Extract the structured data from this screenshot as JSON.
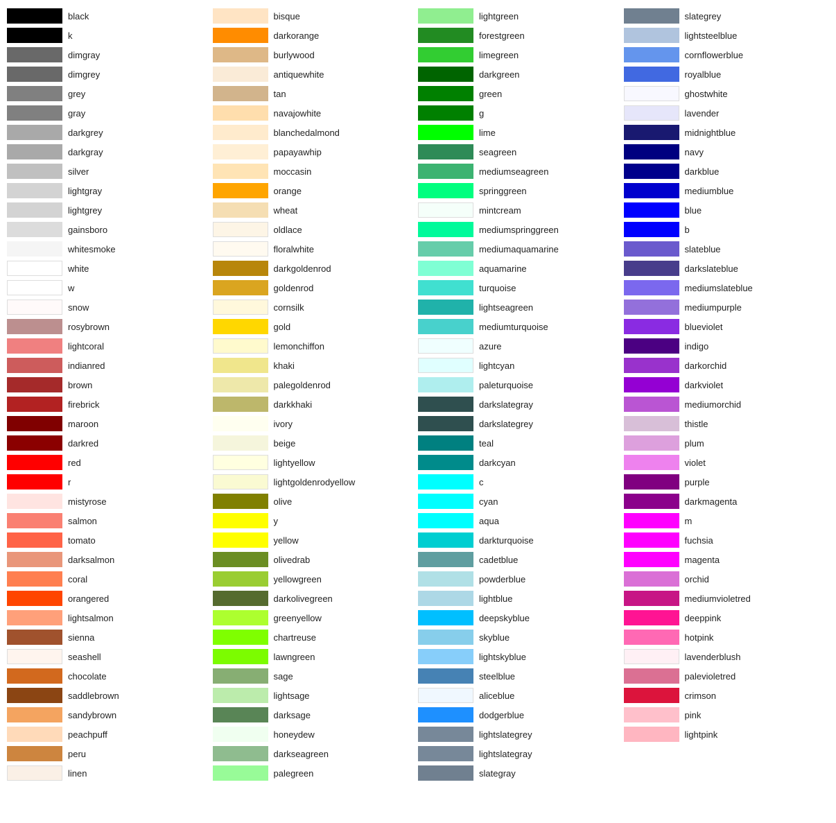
{
  "columns": [
    {
      "id": "col1",
      "items": [
        {
          "name": "black",
          "color": "#000000"
        },
        {
          "name": "k",
          "color": "#000000"
        },
        {
          "name": "dimgray",
          "color": "#696969"
        },
        {
          "name": "dimgrey",
          "color": "#696969"
        },
        {
          "name": "grey",
          "color": "#808080"
        },
        {
          "name": "gray",
          "color": "#808080"
        },
        {
          "name": "darkgrey",
          "color": "#a9a9a9"
        },
        {
          "name": "darkgray",
          "color": "#a9a9a9"
        },
        {
          "name": "silver",
          "color": "#c0c0c0"
        },
        {
          "name": "lightgray",
          "color": "#d3d3d3"
        },
        {
          "name": "lightgrey",
          "color": "#d3d3d3"
        },
        {
          "name": "gainsboro",
          "color": "#dcdcdc"
        },
        {
          "name": "whitesmoke",
          "color": "#f5f5f5"
        },
        {
          "name": "white",
          "color": "#ffffff"
        },
        {
          "name": "w",
          "color": "#ffffff"
        },
        {
          "name": "snow",
          "color": "#fffafa"
        },
        {
          "name": "rosybrown",
          "color": "#bc8f8f"
        },
        {
          "name": "lightcoral",
          "color": "#f08080"
        },
        {
          "name": "indianred",
          "color": "#cd5c5c"
        },
        {
          "name": "brown",
          "color": "#a52a2a"
        },
        {
          "name": "firebrick",
          "color": "#b22222"
        },
        {
          "name": "maroon",
          "color": "#800000"
        },
        {
          "name": "darkred",
          "color": "#8b0000"
        },
        {
          "name": "red",
          "color": "#ff0000"
        },
        {
          "name": "r",
          "color": "#ff0000"
        },
        {
          "name": "mistyrose",
          "color": "#ffe4e1"
        },
        {
          "name": "salmon",
          "color": "#fa8072"
        },
        {
          "name": "tomato",
          "color": "#ff6347"
        },
        {
          "name": "darksalmon",
          "color": "#e9967a"
        },
        {
          "name": "coral",
          "color": "#ff7f50"
        },
        {
          "name": "orangered",
          "color": "#ff4500"
        },
        {
          "name": "lightsalmon",
          "color": "#ffa07a"
        },
        {
          "name": "sienna",
          "color": "#a0522d"
        },
        {
          "name": "seashell",
          "color": "#fff5ee"
        },
        {
          "name": "chocolate",
          "color": "#d2691e"
        },
        {
          "name": "saddlebrown",
          "color": "#8b4513"
        },
        {
          "name": "sandybrown",
          "color": "#f4a460"
        },
        {
          "name": "peachpuff",
          "color": "#ffdab9"
        },
        {
          "name": "peru",
          "color": "#cd853f"
        },
        {
          "name": "linen",
          "color": "#faf0e6"
        }
      ]
    },
    {
      "id": "col2",
      "items": [
        {
          "name": "bisque",
          "color": "#ffe4c4"
        },
        {
          "name": "darkorange",
          "color": "#ff8c00"
        },
        {
          "name": "burlywood",
          "color": "#deb887"
        },
        {
          "name": "antiquewhite",
          "color": "#faebd7"
        },
        {
          "name": "tan",
          "color": "#d2b48c"
        },
        {
          "name": "navajowhite",
          "color": "#ffdead"
        },
        {
          "name": "blanchedalmond",
          "color": "#ffebcd"
        },
        {
          "name": "papayawhip",
          "color": "#ffefd5"
        },
        {
          "name": "moccasin",
          "color": "#ffe4b5"
        },
        {
          "name": "orange",
          "color": "#ffa500"
        },
        {
          "name": "wheat",
          "color": "#f5deb3"
        },
        {
          "name": "oldlace",
          "color": "#fdf5e6"
        },
        {
          "name": "floralwhite",
          "color": "#fffaf0"
        },
        {
          "name": "darkgoldenrod",
          "color": "#b8860b"
        },
        {
          "name": "goldenrod",
          "color": "#daa520"
        },
        {
          "name": "cornsilk",
          "color": "#fff8dc"
        },
        {
          "name": "gold",
          "color": "#ffd700"
        },
        {
          "name": "lemonchiffon",
          "color": "#fffacd"
        },
        {
          "name": "khaki",
          "color": "#f0e68c"
        },
        {
          "name": "palegoldenrod",
          "color": "#eee8aa"
        },
        {
          "name": "darkkhaki",
          "color": "#bdb76b"
        },
        {
          "name": "ivory",
          "color": "#fffff0"
        },
        {
          "name": "beige",
          "color": "#f5f5dc"
        },
        {
          "name": "lightyellow",
          "color": "#ffffe0"
        },
        {
          "name": "lightgoldenrodyellow",
          "color": "#fafad2"
        },
        {
          "name": "olive",
          "color": "#808000"
        },
        {
          "name": "y",
          "color": "#ffff00"
        },
        {
          "name": "yellow",
          "color": "#ffff00"
        },
        {
          "name": "olivedrab",
          "color": "#6b8e23"
        },
        {
          "name": "yellowgreen",
          "color": "#9acd32"
        },
        {
          "name": "darkolivegreen",
          "color": "#556b2f"
        },
        {
          "name": "greenyellow",
          "color": "#adff2f"
        },
        {
          "name": "chartreuse",
          "color": "#7fff00"
        },
        {
          "name": "lawngreen",
          "color": "#7cfc00"
        },
        {
          "name": "sage",
          "color": "#87ae73"
        },
        {
          "name": "lightsage",
          "color": "#bcecac"
        },
        {
          "name": "darksage",
          "color": "#598556"
        },
        {
          "name": "honeydew",
          "color": "#f0fff0"
        },
        {
          "name": "darkseagreen",
          "color": "#8fbc8f"
        },
        {
          "name": "palegreen",
          "color": "#98fb98"
        }
      ]
    },
    {
      "id": "col3",
      "items": [
        {
          "name": "lightgreen",
          "color": "#90ee90"
        },
        {
          "name": "forestgreen",
          "color": "#228b22"
        },
        {
          "name": "limegreen",
          "color": "#32cd32"
        },
        {
          "name": "darkgreen",
          "color": "#006400"
        },
        {
          "name": "green",
          "color": "#008000"
        },
        {
          "name": "g",
          "color": "#008000"
        },
        {
          "name": "lime",
          "color": "#00ff00"
        },
        {
          "name": "seagreen",
          "color": "#2e8b57"
        },
        {
          "name": "mediumseagreen",
          "color": "#3cb371"
        },
        {
          "name": "springgreen",
          "color": "#00ff7f"
        },
        {
          "name": "mintcream",
          "color": "#f5fffa"
        },
        {
          "name": "mediumspringgreen",
          "color": "#00fa9a"
        },
        {
          "name": "mediumaquamarine",
          "color": "#66cdaa"
        },
        {
          "name": "aquamarine",
          "color": "#7fffd4"
        },
        {
          "name": "turquoise",
          "color": "#40e0d0"
        },
        {
          "name": "lightseagreen",
          "color": "#20b2aa"
        },
        {
          "name": "mediumturquoise",
          "color": "#48d1cc"
        },
        {
          "name": "azure",
          "color": "#f0ffff"
        },
        {
          "name": "lightcyan",
          "color": "#e0ffff"
        },
        {
          "name": "paleturquoise",
          "color": "#afeeee"
        },
        {
          "name": "darkslategray",
          "color": "#2f4f4f"
        },
        {
          "name": "darkslategrey",
          "color": "#2f4f4f"
        },
        {
          "name": "teal",
          "color": "#008080"
        },
        {
          "name": "darkcyan",
          "color": "#008b8b"
        },
        {
          "name": "c",
          "color": "#00ffff"
        },
        {
          "name": "cyan",
          "color": "#00ffff"
        },
        {
          "name": "aqua",
          "color": "#00ffff"
        },
        {
          "name": "darkturquoise",
          "color": "#00ced1"
        },
        {
          "name": "cadetblue",
          "color": "#5f9ea0"
        },
        {
          "name": "powderblue",
          "color": "#b0e0e6"
        },
        {
          "name": "lightblue",
          "color": "#add8e6"
        },
        {
          "name": "deepskyblue",
          "color": "#00bfff"
        },
        {
          "name": "skyblue",
          "color": "#87ceeb"
        },
        {
          "name": "lightskyblue",
          "color": "#87cefa"
        },
        {
          "name": "steelblue",
          "color": "#4682b4"
        },
        {
          "name": "aliceblue",
          "color": "#f0f8ff"
        },
        {
          "name": "dodgerblue",
          "color": "#1e90ff"
        },
        {
          "name": "lightslategrey",
          "color": "#778899"
        },
        {
          "name": "lightslategray",
          "color": "#778899"
        },
        {
          "name": "slategray",
          "color": "#708090"
        }
      ]
    },
    {
      "id": "col4",
      "items": [
        {
          "name": "slategrey",
          "color": "#708090"
        },
        {
          "name": "lightsteelblue",
          "color": "#b0c4de"
        },
        {
          "name": "cornflowerblue",
          "color": "#6495ed"
        },
        {
          "name": "royalblue",
          "color": "#4169e1"
        },
        {
          "name": "ghostwhite",
          "color": "#f8f8ff"
        },
        {
          "name": "lavender",
          "color": "#e6e6fa"
        },
        {
          "name": "midnightblue",
          "color": "#191970"
        },
        {
          "name": "navy",
          "color": "#000080"
        },
        {
          "name": "darkblue",
          "color": "#00008b"
        },
        {
          "name": "mediumblue",
          "color": "#0000cd"
        },
        {
          "name": "blue",
          "color": "#0000ff"
        },
        {
          "name": "b",
          "color": "#0000ff"
        },
        {
          "name": "slateblue",
          "color": "#6a5acd"
        },
        {
          "name": "darkslateblue",
          "color": "#483d8b"
        },
        {
          "name": "mediumslateblue",
          "color": "#7b68ee"
        },
        {
          "name": "mediumpurple",
          "color": "#9370db"
        },
        {
          "name": "blueviolet",
          "color": "#8a2be2"
        },
        {
          "name": "indigo",
          "color": "#4b0082"
        },
        {
          "name": "darkorchid",
          "color": "#9932cc"
        },
        {
          "name": "darkviolet",
          "color": "#9400d3"
        },
        {
          "name": "mediumorchid",
          "color": "#ba55d3"
        },
        {
          "name": "thistle",
          "color": "#d8bfd8"
        },
        {
          "name": "plum",
          "color": "#dda0dd"
        },
        {
          "name": "violet",
          "color": "#ee82ee"
        },
        {
          "name": "purple",
          "color": "#800080"
        },
        {
          "name": "darkmagenta",
          "color": "#8b008b"
        },
        {
          "name": "m",
          "color": "#ff00ff"
        },
        {
          "name": "fuchsia",
          "color": "#ff00ff"
        },
        {
          "name": "magenta",
          "color": "#ff00ff"
        },
        {
          "name": "orchid",
          "color": "#da70d6"
        },
        {
          "name": "mediumvioletred",
          "color": "#c71585"
        },
        {
          "name": "deeppink",
          "color": "#ff1493"
        },
        {
          "name": "hotpink",
          "color": "#ff69b4"
        },
        {
          "name": "lavenderblush",
          "color": "#fff0f5"
        },
        {
          "name": "palevioletred",
          "color": "#db7093"
        },
        {
          "name": "crimson",
          "color": "#dc143c"
        },
        {
          "name": "pink",
          "color": "#ffc0cb"
        },
        {
          "name": "lightpink",
          "color": "#ffb6c1"
        },
        {
          "name": "",
          "color": ""
        },
        {
          "name": "",
          "color": ""
        }
      ]
    }
  ]
}
